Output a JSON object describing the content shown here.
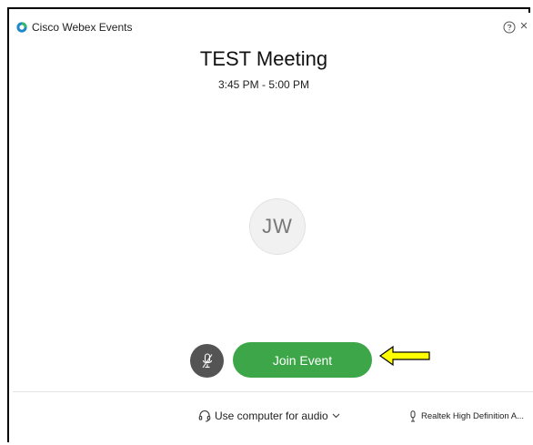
{
  "window": {
    "title": "Cisco Webex Events",
    "close_glyph": "×"
  },
  "meeting": {
    "title": "TEST Meeting",
    "time": "3:45 PM - 5:00 PM"
  },
  "avatar": {
    "initials": "JW"
  },
  "actions": {
    "join_label": "Join Event",
    "mute_icon": "microphone-muted-icon"
  },
  "audio": {
    "connection_label": "Use computer for audio",
    "connection_icon": "headset-icon",
    "microphone_label": "Realtek High Definition A...",
    "microphone_icon": "microphone-icon"
  },
  "colors": {
    "join_button": "#3da648",
    "mute_button": "#545454",
    "annotation_arrow": "#ffff00",
    "logo_blue": "#1e88c9",
    "logo_green": "#2fb866"
  }
}
